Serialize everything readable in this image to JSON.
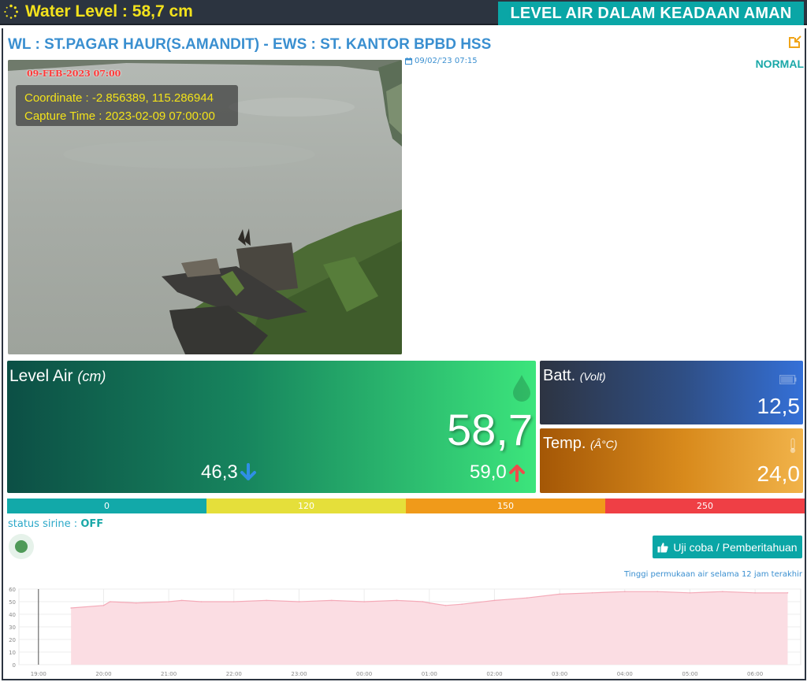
{
  "header": {
    "water_level": "Water Level : 58,7 cm",
    "status_banner": "LEVEL AIR DALAM KEADAAN AMAN"
  },
  "station": {
    "title": "WL : ST.PAGAR HAUR(S.AMANDIT) - EWS : ST. KANTOR BPBD HSS",
    "timestamp": "09/02/'23 07:15",
    "status": "NORMAL"
  },
  "camera": {
    "stamp": "09-FEB-2023 07:00",
    "coordinate": "Coordinate : -2.856389, 115.286944",
    "capture_time": "Capture Time : 2023-02-09 07:00:00"
  },
  "level": {
    "title": "Level Air",
    "unit": "(cm)",
    "value": "58,7",
    "min": "46,3",
    "max": "59,0"
  },
  "battery": {
    "title": "Batt.",
    "unit": "(Volt)",
    "value": "12,5"
  },
  "temperature": {
    "title": "Temp.",
    "unit": "(Â°C)",
    "value": "24,0"
  },
  "scale": {
    "labels": [
      "0",
      "120",
      "150",
      "250"
    ],
    "colors": [
      "#12a9a9",
      "#e5df3a",
      "#f09a1a",
      "#ef3f45"
    ]
  },
  "siren": {
    "label": "status sirine :",
    "state": "OFF"
  },
  "test_button": {
    "label": "Uji coba / Pemberitahuan"
  },
  "colors": {
    "accent": "#0aa6a6",
    "title_blue": "#3a8fd0",
    "area_fill": "#fbdde3",
    "area_line": "#f4aab8"
  },
  "chart_data": {
    "type": "area",
    "title": "Tinggi permukaan air selama 12 jam terakhir",
    "xlabel": "",
    "ylabel": "",
    "ylim": [
      0,
      60
    ],
    "yticks": [
      0,
      10,
      20,
      30,
      40,
      50,
      60
    ],
    "xticks": [
      "19:00",
      "20:00",
      "21:00",
      "22:00",
      "23:00",
      "00:00",
      "01:00",
      "02:00",
      "03:00",
      "04:00",
      "05:00",
      "06:00"
    ],
    "x": [
      19.5,
      20.0,
      20.1,
      20.5,
      21.0,
      21.2,
      21.5,
      22.0,
      22.5,
      23.0,
      23.5,
      24.0,
      24.5,
      24.9,
      25.0,
      25.25,
      25.5,
      26.0,
      26.5,
      27.0,
      27.5,
      28.0,
      28.5,
      29.0,
      29.5,
      30.0,
      30.5
    ],
    "y": [
      45,
      47,
      50,
      49,
      50,
      51,
      50,
      50,
      51,
      50,
      51,
      50,
      51,
      50,
      49,
      47,
      48,
      51,
      53,
      56,
      57,
      58,
      58,
      57,
      58,
      57,
      57
    ],
    "grid": true,
    "legend": "none"
  }
}
